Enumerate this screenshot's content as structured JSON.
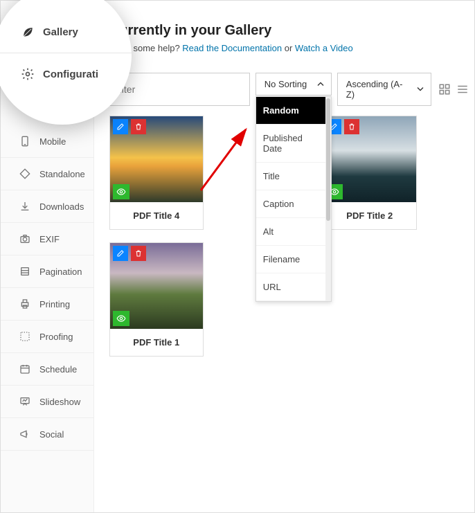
{
  "spotlight": {
    "gallery_label": "Gallery",
    "config_label": "Configurati"
  },
  "sidebar": {
    "items": [
      {
        "label": "Mobile"
      },
      {
        "label": "Standalone"
      },
      {
        "label": "Downloads"
      },
      {
        "label": "EXIF"
      },
      {
        "label": "Pagination"
      },
      {
        "label": "Printing"
      },
      {
        "label": "Proofing"
      },
      {
        "label": "Schedule"
      },
      {
        "label": "Slideshow"
      },
      {
        "label": "Social"
      }
    ]
  },
  "header": {
    "title": "Currently in your Gallery",
    "help_prefix": "Need some help? ",
    "doc_link": "Read the Documentation",
    "help_mid": " or ",
    "video_link": "Watch a Video"
  },
  "controls": {
    "filter_placeholder": "filter",
    "sort_label": "No Sorting",
    "direction_label": "Ascending (A-Z)",
    "sort_options": [
      "Random",
      "Published Date",
      "Title",
      "Caption",
      "Alt",
      "Filename",
      "URL"
    ]
  },
  "cards": [
    {
      "title": "PDF Title 4"
    },
    {
      "title": "PDF Title 2"
    },
    {
      "title": "PDF Title 1"
    }
  ]
}
